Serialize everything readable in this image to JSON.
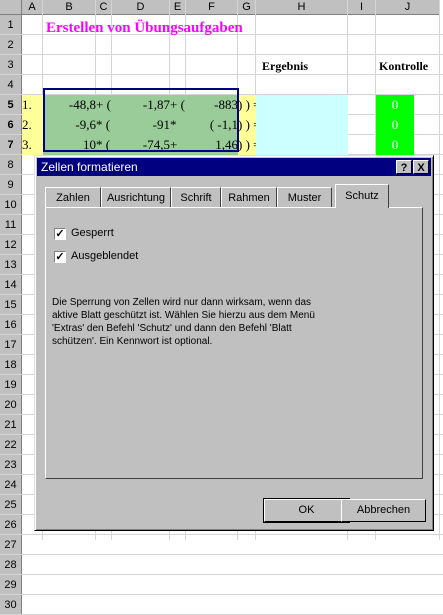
{
  "sheet": {
    "columns": [
      "A",
      "B",
      "C",
      "D",
      "E",
      "F",
      "G",
      "H",
      "I",
      "J"
    ],
    "rows": [
      "1",
      "2",
      "3",
      "4",
      "5",
      "6",
      "7",
      "8",
      "9",
      "10",
      "11",
      "12",
      "13",
      "14",
      "15",
      "16",
      "17",
      "18",
      "19",
      "20",
      "21",
      "22",
      "23",
      "24",
      "25",
      "26",
      "27",
      "28",
      "29",
      "30"
    ],
    "title": "Erstellen von Übungsaufgaben",
    "ergebnis_label": "Ergebnis",
    "kontrolle_label": "Kontrolle",
    "tasks": [
      {
        "num": "1.",
        "b": "-48,8",
        "c": "+ (",
        "d": "-1,87",
        "e": "+ (",
        "f": "-883",
        "close": ") ) =",
        "kontrolle": "0"
      },
      {
        "num": "2.",
        "b": "-9,6",
        "c": "* (",
        "d": "-91",
        "e": "*",
        "f": "( -1,1",
        "close": ") ) =",
        "kontrolle": "0"
      },
      {
        "num": "3.",
        "b": "10",
        "c": "* (",
        "d": "-74,5",
        "e": "+",
        "f": "1,46",
        "close": ") ) =",
        "kontrolle": "0"
      }
    ]
  },
  "dialog": {
    "title": "Zellen formatieren",
    "help_btn": "?",
    "close_btn": "X",
    "tabs": [
      "Zahlen",
      "Ausrichtung",
      "Schrift",
      "Rahmen",
      "Muster",
      "Schutz"
    ],
    "active_tab": "Schutz",
    "checkboxes": [
      {
        "label": "Gesperrt",
        "checked": true,
        "mark": "✓"
      },
      {
        "label": "Ausgeblendet",
        "checked": true,
        "mark": "✓"
      }
    ],
    "info_lines": [
      "Die Sperrung von Zellen wird nur dann wirksam, wenn das",
      "aktive Blatt geschützt ist. Wählen Sie hierzu aus dem Menü",
      "'Extras' den Befehl 'Schutz' und dann den Befehl 'Blatt",
      "schützen'. Ein Kennwort ist optional."
    ],
    "ok_label": "OK",
    "cancel_label": "Abbrechen"
  },
  "colors": {
    "title": "#ff00ff",
    "cell_yellow": "#ffff99",
    "cell_green": "#99cc99",
    "cell_cyan": "#ccffff",
    "kontrolle_green": "#00ff00",
    "selection_border": "#000080",
    "dialog_titlebar": "#000080"
  }
}
